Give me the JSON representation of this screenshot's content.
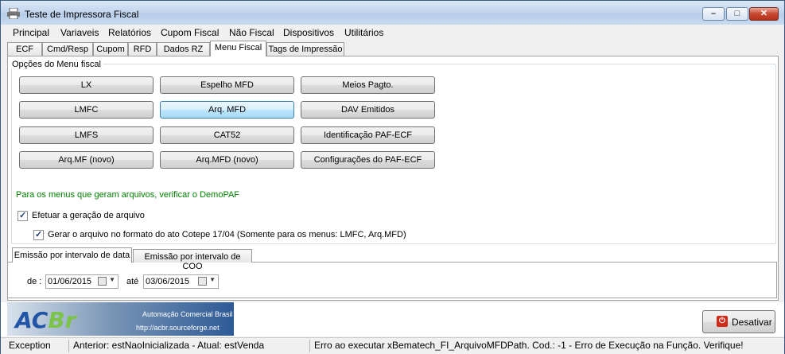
{
  "window": {
    "title": "Teste de Impressora Fiscal"
  },
  "menu": [
    "Principal",
    "Variaveis",
    "Relatórios",
    "Cupom Fiscal",
    "Não Fiscal",
    "Dispositivos",
    "Utilitários"
  ],
  "tabs": [
    "ECF",
    "Cmd/Resp",
    "Cupom",
    "RFD",
    "Dados RZ",
    "Menu Fiscal",
    "Tags de Impressão"
  ],
  "group_label": "Opções do Menu fiscal",
  "buttons": {
    "lx": "LX",
    "espelho": "Espelho MFD",
    "meios": "Meios Pagto.",
    "lmfc": "LMFC",
    "arqmfd": "Arq. MFD",
    "dav": "DAV Emitidos",
    "lmfs": "LMFS",
    "cat52": "CAT52",
    "ident": "Identificação PAF-ECF",
    "arqmf_novo": "Arq.MF (novo)",
    "arqmfd_novo": "Arq.MFD (novo)",
    "config": "Configurações do PAF-ECF"
  },
  "hint": "Para os menus que geram arquivos, verificar o DemoPAF",
  "checkboxes": {
    "gerar": {
      "label": "Efetuar a geração de arquivo",
      "checked": true
    },
    "cotepe": {
      "label": "Gerar o arquivo no formato do ato Cotepe 17/04 (Somente para os menus: LMFC, Arq.MFD)",
      "checked": true
    }
  },
  "subtabs": [
    "Emissão por intervalo de data",
    "Emissão por intervalo de COO"
  ],
  "dates": {
    "de_label": "de :",
    "de_value": "01/06/2015",
    "ate_label": "até",
    "ate_value": "03/06/2015"
  },
  "logo": {
    "text": "ACBr",
    "line1": "Automação Comercial Brasil",
    "line2": "http://acbr.sourceforge.net"
  },
  "desativar": "Desativar",
  "status": {
    "left": "Exception",
    "middle": "Anterior: estNaoInicializada - Atual: estVenda",
    "right": "Erro ao executar xBematech_FI_ArquivoMFDPath.  Cod.: -1 - Erro de Execução na Função. Verifique!"
  }
}
